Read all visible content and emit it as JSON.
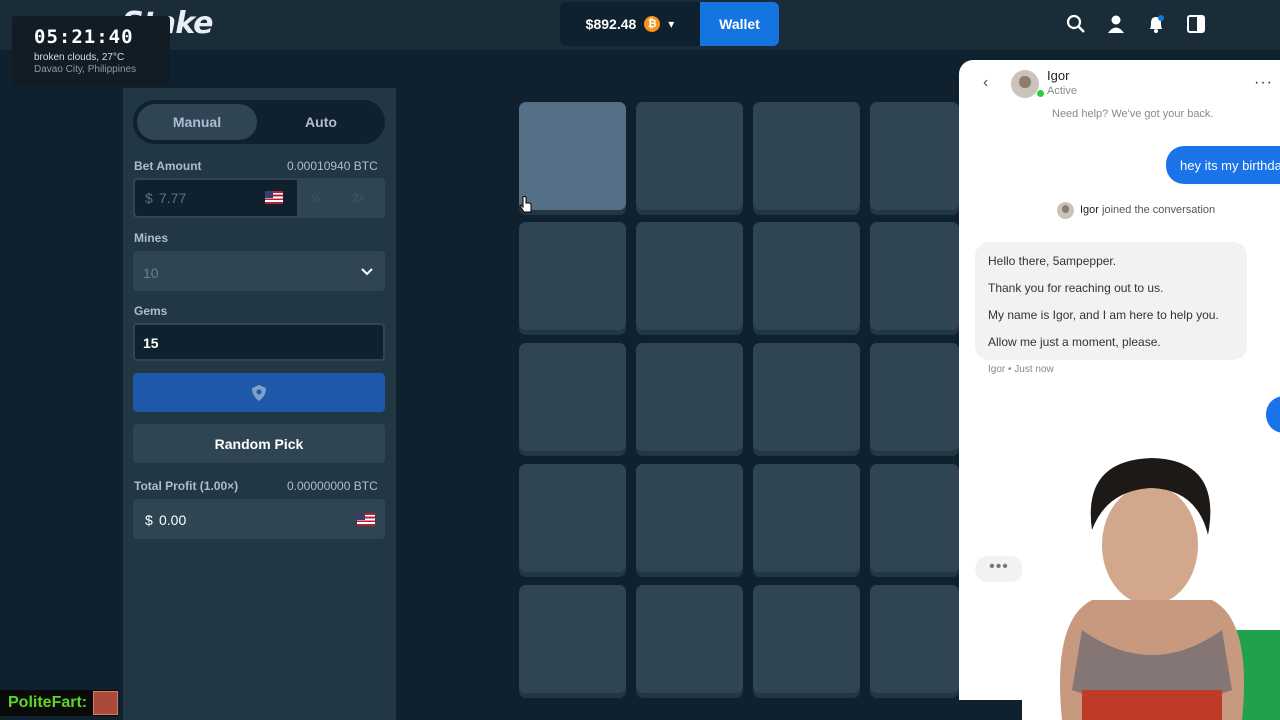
{
  "overlay": {
    "clock": {
      "time": "05:21:40",
      "weather": "broken clouds, 27°C",
      "location": "Davao City, Philippines"
    },
    "chat_user": "PoliteFart:"
  },
  "topbar": {
    "logo": "Stake",
    "balance": "$892.48",
    "currency_icon": "bitcoin-icon",
    "wallet_label": "Wallet",
    "icons": [
      "search-icon",
      "user-icon",
      "notifications-icon",
      "sidebar-toggle-icon"
    ]
  },
  "sidebar": {
    "tabs": [
      {
        "label": "Manual",
        "active": true
      },
      {
        "label": "Auto",
        "active": false
      }
    ],
    "bet_amount": {
      "label": "Bet Amount",
      "btc": "0.00010940 BTC",
      "value": "7.77",
      "currency_symbol": "$",
      "half": "½",
      "double": "2×"
    },
    "mines": {
      "label": "Mines",
      "value": "10"
    },
    "gems": {
      "label": "Gems",
      "value": "15"
    },
    "bet_button_icon": "shield-icon",
    "random_pick_label": "Random Pick",
    "total_profit": {
      "label": "Total Profit (1.00×)",
      "btc": "0.00000000 BTC",
      "currency_symbol": "$",
      "value": "0.00"
    }
  },
  "grid": {
    "rows": 5,
    "visible_cols": 4,
    "hovered_tile": [
      0,
      0
    ]
  },
  "chat": {
    "agent_name": "Igor",
    "agent_status": "Active",
    "help_text": "Need help? We've got your back.",
    "user_message": "hey its my birthda",
    "joined_name": "Igor",
    "joined_text": " joined the conversation",
    "agent_messages": [
      "Hello there, 5ampepper.",
      "Thank you for reaching out to us.",
      "My name is Igor, and I am here to help you.",
      "Allow me just a moment, please."
    ],
    "agent_meta": "Igor • Just now"
  }
}
